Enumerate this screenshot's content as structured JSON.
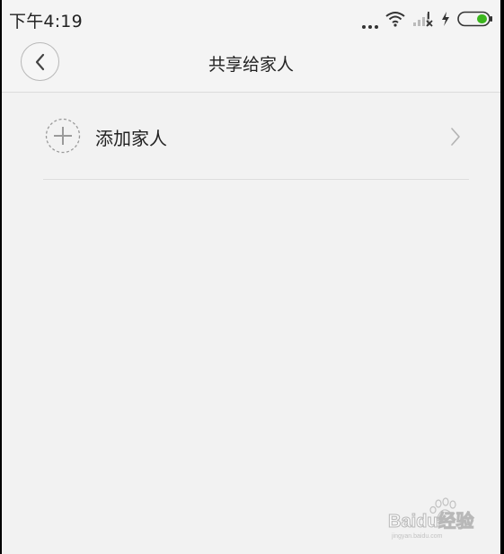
{
  "status_bar": {
    "time": "下午4:19"
  },
  "header": {
    "title": "共享给家人"
  },
  "list": {
    "items": [
      {
        "label": "添加家人"
      }
    ]
  },
  "watermark": {
    "text": "Baidu经验"
  },
  "colors": {
    "background": "#f2f2f2",
    "battery_fill": "#3cb61e",
    "text": "#222222",
    "divider": "#dedede"
  }
}
